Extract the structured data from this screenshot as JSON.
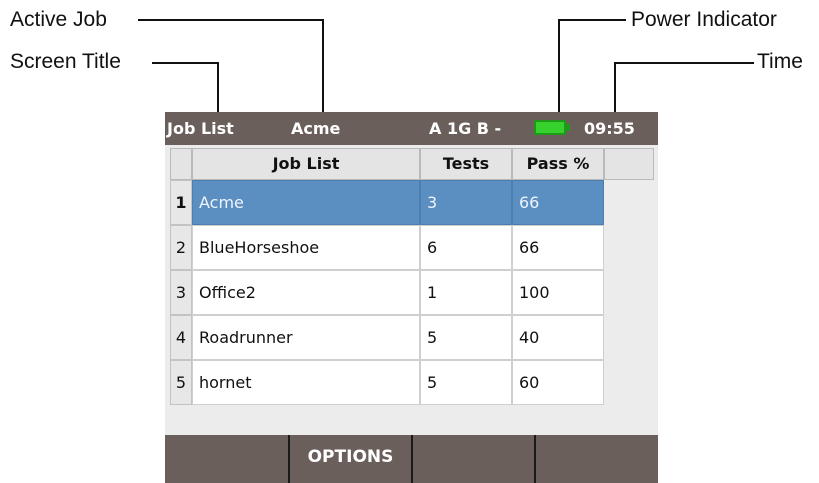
{
  "callouts": {
    "active_job": "Active Job",
    "screen_title": "Screen Title",
    "power_indicator": "Power Indicator",
    "time": "Time"
  },
  "titlebar": {
    "title": "Job List",
    "active_job": "Acme",
    "port_status": "A 1G B -",
    "battery_icon": "battery-full-icon",
    "battery_color": "#37d12e",
    "time": "09:55"
  },
  "table": {
    "headers": {
      "job": "Job List",
      "tests": "Tests",
      "pass": "Pass %"
    },
    "rows": [
      {
        "num": "1",
        "job": "Acme",
        "tests": "3",
        "pass": "66"
      },
      {
        "num": "2",
        "job": "BlueHorseshoe",
        "tests": "6",
        "pass": "66"
      },
      {
        "num": "3",
        "job": "Office2",
        "tests": "1",
        "pass": "100"
      },
      {
        "num": "4",
        "job": "Roadrunner",
        "tests": "5",
        "pass": "40"
      },
      {
        "num": "5",
        "job": "hornet",
        "tests": "5",
        "pass": "60"
      }
    ],
    "selected_row": "1",
    "selection_color": "#5b8fc2"
  },
  "softkeys": {
    "key1": "",
    "key2": "OPTIONS",
    "key3": "",
    "key4": ""
  },
  "colors": {
    "titlebar": "#6b5f5b",
    "softkeys": "#6b5f5b"
  }
}
